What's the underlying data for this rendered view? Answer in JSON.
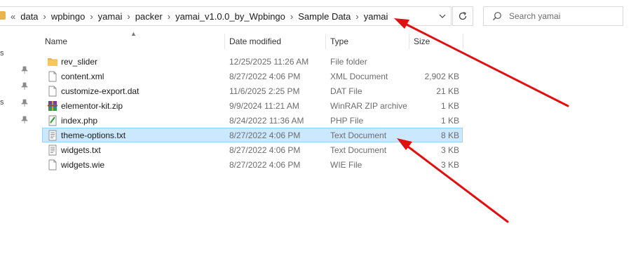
{
  "address_bar": {
    "overflow_chevron": "«",
    "crumbs": [
      "data",
      "wpbingo",
      "yamai",
      "packer",
      "yamai_v1.0.0_by_Wpbingo",
      "Sample Data",
      "yamai"
    ]
  },
  "search": {
    "placeholder": "Search yamai"
  },
  "columns": {
    "name": "Name",
    "date": "Date modified",
    "type": "Type",
    "size": "Size"
  },
  "files": [
    {
      "name": "rev_slider",
      "date": "12/25/2025 11:26 AM",
      "type": "File folder",
      "size": "",
      "icon": "folder-icon"
    },
    {
      "name": "content.xml",
      "date": "8/27/2022 4:06 PM",
      "type": "XML Document",
      "size": "2,902 KB",
      "icon": "file-icon"
    },
    {
      "name": "customize-export.dat",
      "date": "11/6/2025 2:25 PM",
      "type": "DAT File",
      "size": "21 KB",
      "icon": "file-icon"
    },
    {
      "name": "elementor-kit.zip",
      "date": "9/9/2024 11:21 AM",
      "type": "WinRAR ZIP archive",
      "size": "1 KB",
      "icon": "winrar-archive-icon"
    },
    {
      "name": "index.php",
      "date": "8/24/2022 11:36 AM",
      "type": "PHP File",
      "size": "1 KB",
      "icon": "php-file-icon"
    },
    {
      "name": "theme-options.txt",
      "date": "8/27/2022 4:06 PM",
      "type": "Text Document",
      "size": "8 KB",
      "icon": "text-file-icon",
      "selected": true
    },
    {
      "name": "widgets.txt",
      "date": "8/27/2022 4:06 PM",
      "type": "Text Document",
      "size": "3 KB",
      "icon": "text-file-icon"
    },
    {
      "name": "widgets.wie",
      "date": "8/27/2022 4:06 PM",
      "type": "WIE File",
      "size": "3 KB",
      "icon": "file-icon"
    }
  ],
  "colors": {
    "selection_bg": "#cce8ff",
    "selection_border": "#99d1ff",
    "annotation_arrow": "#e01010",
    "folder": "#e8b54a"
  }
}
